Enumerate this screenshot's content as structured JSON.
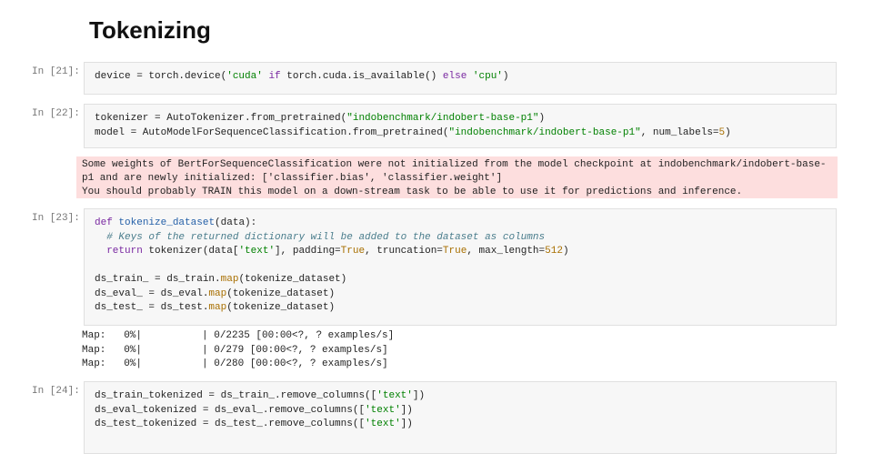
{
  "heading": "Tokenizing",
  "cells": [
    {
      "prompt": "In [21]:",
      "lines": [
        [
          [
            "",
            "device = torch.device("
          ],
          [
            "str",
            "'cuda'"
          ],
          [
            "",
            " "
          ],
          [
            "kw",
            "if"
          ],
          [
            "",
            " torch.cuda.is_available() "
          ],
          [
            "kw",
            "else"
          ],
          [
            "",
            " "
          ],
          [
            "str",
            "'cpu'"
          ],
          [
            "",
            ")"
          ]
        ]
      ]
    },
    {
      "prompt": "In [22]:",
      "lines": [
        [
          [
            "",
            "tokenizer = AutoTokenizer.from_pretrained("
          ],
          [
            "str",
            "\"indobenchmark/indobert-base-p1\""
          ],
          [
            "",
            ")"
          ]
        ],
        [
          [
            "",
            "model = AutoModelForSequenceClassification.from_pretrained("
          ],
          [
            "str",
            "\"indobenchmark/indobert-base-p1\""
          ],
          [
            "",
            ", num_labels="
          ],
          [
            "num",
            "5"
          ],
          [
            "",
            ")"
          ]
        ]
      ]
    },
    {
      "prompt": "In [23]:",
      "lines": [
        [
          [
            "kw",
            "def"
          ],
          [
            "",
            " "
          ],
          [
            "fn",
            "tokenize_dataset"
          ],
          [
            "",
            "(data):"
          ]
        ],
        [
          [
            "",
            "  "
          ],
          [
            "cm",
            "# Keys of the returned dictionary will be added to the dataset as columns"
          ]
        ],
        [
          [
            "",
            "  "
          ],
          [
            "kw",
            "return"
          ],
          [
            "",
            " tokenizer(data["
          ],
          [
            "str",
            "'text'"
          ],
          [
            "",
            "], padding="
          ],
          [
            "num",
            "True"
          ],
          [
            "",
            ", truncation="
          ],
          [
            "num",
            "True"
          ],
          [
            "",
            ", max_length="
          ],
          [
            "num",
            "512"
          ],
          [
            "",
            ")"
          ]
        ],
        [
          [
            "",
            ""
          ]
        ],
        [
          [
            "",
            "ds_train_ = ds_train."
          ],
          [
            "num",
            "map"
          ],
          [
            "",
            "(tokenize_dataset)"
          ]
        ],
        [
          [
            "",
            "ds_eval_ = ds_eval."
          ],
          [
            "num",
            "map"
          ],
          [
            "",
            "(tokenize_dataset)"
          ]
        ],
        [
          [
            "",
            "ds_test_ = ds_test."
          ],
          [
            "num",
            "map"
          ],
          [
            "",
            "(tokenize_dataset)"
          ]
        ]
      ]
    },
    {
      "prompt": "In [24]:",
      "lines": [
        [
          [
            "",
            "ds_train_tokenized = ds_train_.remove_columns(["
          ],
          [
            "str",
            "'text'"
          ],
          [
            "",
            "])"
          ]
        ],
        [
          [
            "",
            "ds_eval_tokenized = ds_eval_.remove_columns(["
          ],
          [
            "str",
            "'text'"
          ],
          [
            "",
            "])"
          ]
        ],
        [
          [
            "",
            "ds_test_tokenized = ds_test_.remove_columns(["
          ],
          [
            "str",
            "'text'"
          ],
          [
            "",
            "])"
          ]
        ]
      ]
    }
  ],
  "warning": {
    "lines": [
      "Some weights of BertForSequenceClassification were not initialized from the model checkpoint at indobenchmark/indobert-base-p1 and are newly initialized: ['classifier.bias', 'classifier.weight']",
      "You should probably TRAIN this model on a down-stream task to be able to use it for predictions and inference."
    ]
  },
  "progress": [
    {
      "text": "Map:   0%|          | 0/2235 [00:00<?, ? examples/s]",
      "percent": 0
    },
    {
      "text": "Map:   0%|          | 0/279 [00:00<?, ? examples/s]",
      "percent": 0
    },
    {
      "text": "Map:   0%|          | 0/280 [00:00<?, ? examples/s]",
      "percent": 0
    }
  ]
}
